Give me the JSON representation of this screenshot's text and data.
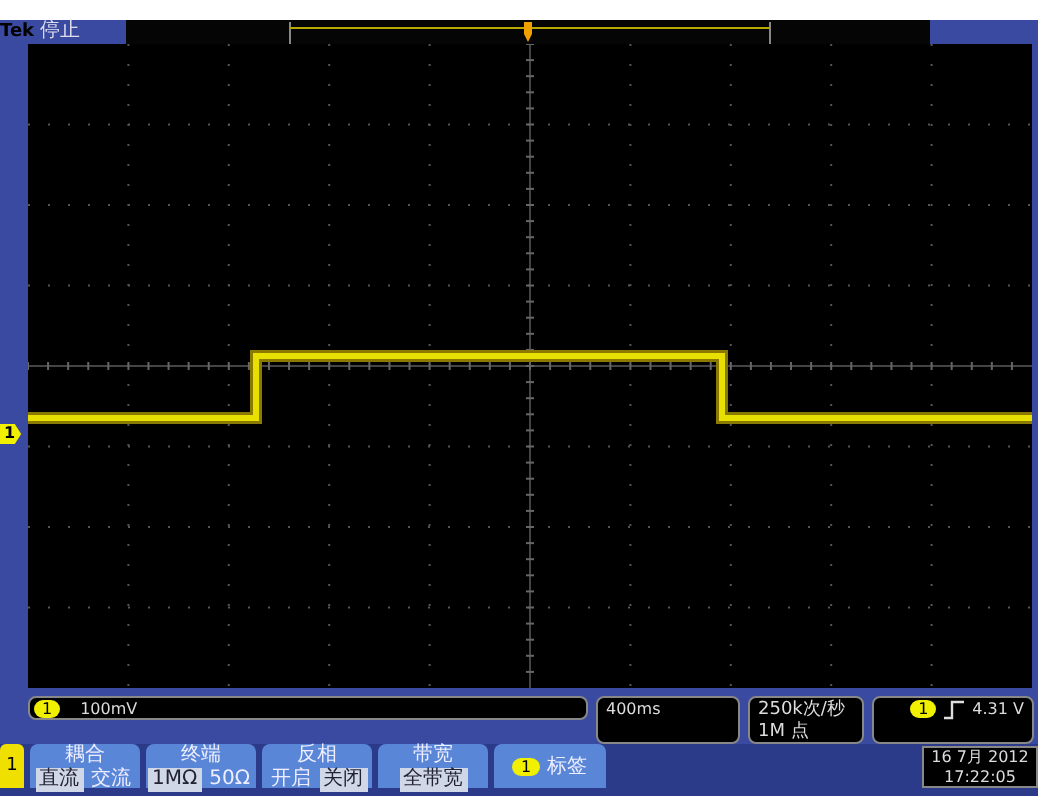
{
  "status_bar": {
    "brand": "Tek",
    "state": "停止"
  },
  "channel_marker": "1",
  "readouts": {
    "channel": {
      "number": "1",
      "scale": "100mV"
    },
    "timebase": "400ms",
    "sample_rate": "250k次/秒",
    "record_length": "1M 点",
    "trigger": {
      "channel": "1",
      "level": "4.31 V"
    }
  },
  "menu": {
    "channel_tab": "1",
    "buttons": [
      {
        "kind": "toggle",
        "title": "耦合",
        "options": [
          {
            "label": "直流",
            "selected": true
          },
          {
            "label": "交流",
            "selected": false
          }
        ]
      },
      {
        "kind": "toggle",
        "title": "终端",
        "options": [
          {
            "label": "1MΩ",
            "selected": true
          },
          {
            "label": "50Ω",
            "selected": false
          }
        ]
      },
      {
        "kind": "toggle",
        "title": "反相",
        "options": [
          {
            "label": "开启",
            "selected": false
          },
          {
            "label": "关闭",
            "selected": true
          }
        ]
      },
      {
        "kind": "value",
        "title": "带宽",
        "value": "全带宽"
      },
      {
        "kind": "label",
        "channel": "1",
        "title": "标签"
      }
    ]
  },
  "datetime": {
    "date": "16 7月 2012",
    "time": "17:22:05"
  }
}
